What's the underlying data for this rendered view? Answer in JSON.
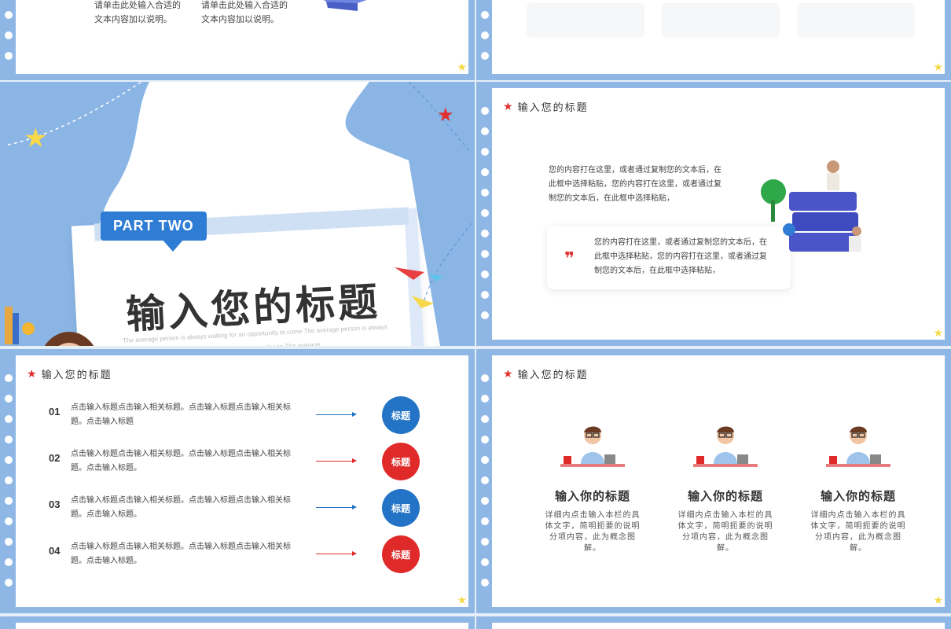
{
  "slide1": {
    "caption_left": "请单击此处输入合适的文本内容加以说明。",
    "caption_right": "请单击此处输入合适的文本内容加以说明。"
  },
  "section": {
    "badge": "PART TWO",
    "title": "输入您的标题",
    "subtitle": "The average person is always waiting for an opportunity to come The average person is always waiting for an The average for an The average"
  },
  "books_slide": {
    "title": "输入您的标题",
    "paragraph": "您的内容打在这里，或者通过复制您的文本后，在此框中选择粘贴，您的内容打在这里，或者通过复制您的文本后，在此框中选择粘贴，",
    "quote_mark": "❞",
    "quote": "您的内容打在这里，或者通过复制您的文本后，在此框中选择粘贴，您的内容打在这里，或者通过复制您的文本后，在此框中选择粘贴，"
  },
  "list_slide": {
    "title": "输入您的标题",
    "rows": [
      {
        "num": "01",
        "text": "点击输入标题点击输入相关标题。点击输入标题点击输入相关标题。点击输入标题",
        "label": "标题",
        "color": "#2373c6"
      },
      {
        "num": "02",
        "text": "点击输入标题点击输入相关标题。点击输入标题点击输入相关标题。点击输入标题。",
        "label": "标题",
        "color": "#e02a2a"
      },
      {
        "num": "03",
        "text": "点击输入标题点击输入相关标题。点击输入标题点击输入相关标题。点击输入标题。",
        "label": "标题",
        "color": "#2373c6"
      },
      {
        "num": "04",
        "text": "点击输入标题点击输入相关标题。点击输入标题点击输入相关标题。点击输入标题。",
        "label": "标题",
        "color": "#e02a2a"
      }
    ]
  },
  "people_slide": {
    "title": "输入您的标题",
    "columns": [
      {
        "heading": "输入你的标题",
        "text": "详细内点击输入本栏的具体文字，简明扼要的说明分项内容，此为概念图解。"
      },
      {
        "heading": "输入你的标题",
        "text": "详细内点击输入本栏的具体文字，简明扼要的说明分项内容，此为概念图解。"
      },
      {
        "heading": "输入你的标题",
        "text": "详细内点击输入本栏的具体文字，简明扼要的说明分项内容，此为概念图解。"
      }
    ]
  },
  "colors": {
    "frame": "#8fb7e6",
    "blue": "#2373c6",
    "red": "#e02a2a",
    "star": "#f6d84a"
  }
}
